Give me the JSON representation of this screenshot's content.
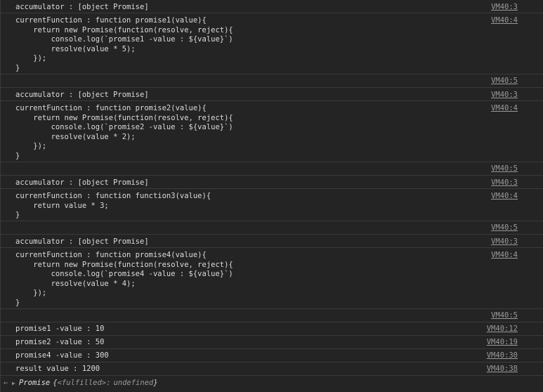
{
  "messages": [
    {
      "text": "accumulator : [object Promise]",
      "source": "VM40:3"
    },
    {
      "text": "currentFunction : function promise1(value){\n    return new Promise(function(resolve, reject){\n        console.log(`promise1 -value : ${value}`)\n        resolve(value * 5);\n    });\n}",
      "source": "VM40:4"
    },
    {
      "text": "",
      "source": "VM40:5"
    },
    {
      "text": "accumulator : [object Promise]",
      "source": "VM40:3"
    },
    {
      "text": "currentFunction : function promise2(value){\n    return new Promise(function(resolve, reject){\n        console.log(`promise2 -value : ${value}`)\n        resolve(value * 2);\n    });\n}",
      "source": "VM40:4"
    },
    {
      "text": "",
      "source": "VM40:5"
    },
    {
      "text": "accumulator : [object Promise]",
      "source": "VM40:3"
    },
    {
      "text": "currentFunction : function function3(value){\n    return value * 3;\n}",
      "source": "VM40:4"
    },
    {
      "text": "",
      "source": "VM40:5"
    },
    {
      "text": "accumulator : [object Promise]",
      "source": "VM40:3"
    },
    {
      "text": "currentFunction : function promise4(value){\n    return new Promise(function(resolve, reject){\n        console.log(`promise4 -value : ${value}`)\n        resolve(value * 4);\n    });\n}",
      "source": "VM40:4"
    },
    {
      "text": "",
      "source": "VM40:5"
    },
    {
      "text": "promise1 -value : 10",
      "source": "VM40:12"
    },
    {
      "text": "promise2 -value : 50",
      "source": "VM40:19"
    },
    {
      "text": "promise4 -value : 300",
      "source": "VM40:30"
    },
    {
      "text": "result value : 1200",
      "source": "VM40:38"
    }
  ],
  "result": {
    "label": "Promise",
    "brace_open": "{",
    "key": "<fulfilled>:",
    "value": "undefined",
    "brace_close": "}"
  },
  "icons": {
    "prompt": "←",
    "expand": "▶"
  }
}
